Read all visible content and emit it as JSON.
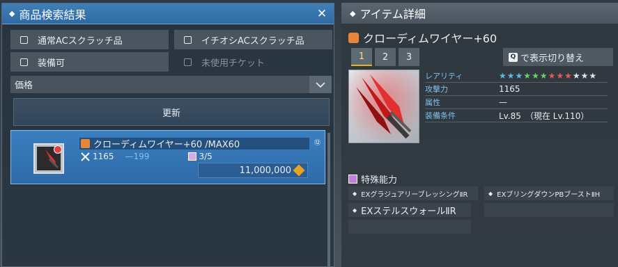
{
  "search": {
    "title": "商品検索結果",
    "close_glyph": "✕",
    "filters": [
      {
        "label": "通常ACスクラッチ品",
        "checked": false,
        "enabled": true
      },
      {
        "label": "イチオシACスクラッチ品",
        "checked": false,
        "enabled": true
      },
      {
        "label": "装備可",
        "checked": false,
        "enabled": true
      },
      {
        "label": "未使用チケット",
        "checked": false,
        "enabled": false
      }
    ],
    "sort_value": "価格",
    "update_label": "更新",
    "results": [
      {
        "name": "クローディムワイヤー+60 /MAX60",
        "attack": "1165",
        "attack_diff": "—199",
        "count": "3/5",
        "price": "11,000,000",
        "badge": "⑫"
      }
    ]
  },
  "detail": {
    "title": "アイテム詳細",
    "item_name": "クローディムワイヤー+60",
    "tabs": [
      "1",
      "2",
      "3"
    ],
    "active_tab": 0,
    "toggle_key": "Q",
    "toggle_label": "で表示切り替え",
    "rarity_label": "レアリティ",
    "rarity_stars": [
      "#5fb8e8",
      "#5fb8e8",
      "#5fb8e8",
      "#6ad06a",
      "#6ad06a",
      "#6ad06a",
      "#e85a5a",
      "#e85a5a",
      "#e85a5a",
      "#dfe4e8",
      "#dfe4e8",
      "#dfe4e8"
    ],
    "rows": [
      {
        "label": "攻撃力",
        "value": "1165"
      },
      {
        "label": "属性",
        "value": "—"
      },
      {
        "label": "装備条件",
        "value": "Lv.85　（現在 Lv.110）"
      }
    ],
    "special_label": "特殊能力",
    "abilities": [
      "EXグラジュアリーブレッシングⅡR",
      "EXブリングダウンPBブーストⅡH",
      "EXステルスウォールⅡR"
    ]
  }
}
